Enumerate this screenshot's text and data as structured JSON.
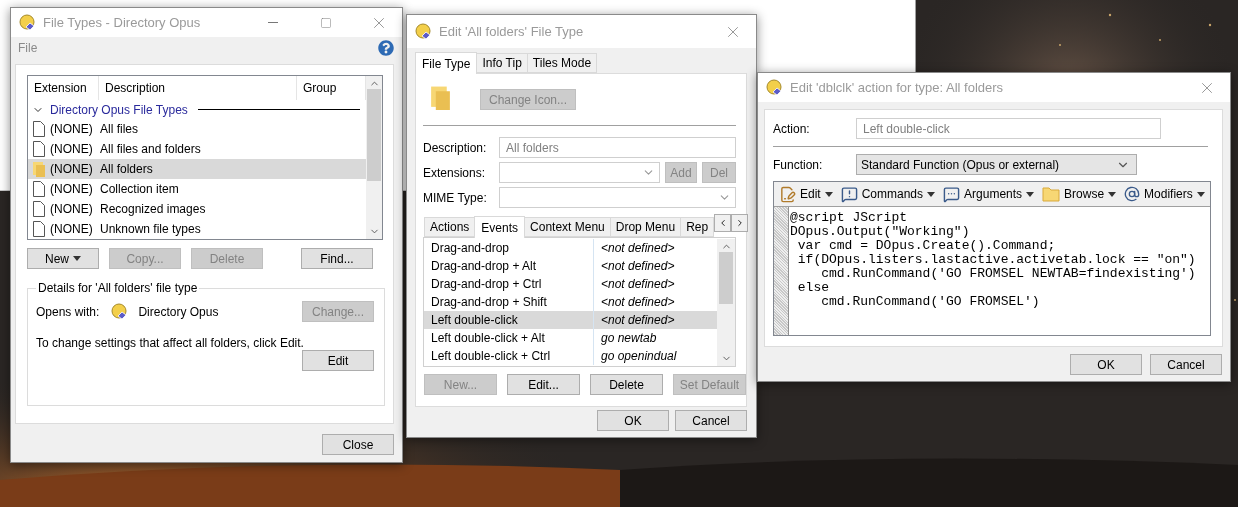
{
  "file_types_window": {
    "title": "File Types - Directory Opus",
    "menu": [
      "File"
    ],
    "table": {
      "columns": [
        "Extension",
        "Description",
        "Group"
      ],
      "group": {
        "label": "Directory Opus File Types",
        "expanded": true
      },
      "rows": [
        {
          "kind": "file",
          "extension": "(NONE)",
          "description": "All files",
          "selected": false
        },
        {
          "kind": "file",
          "extension": "(NONE)",
          "description": "All files and folders",
          "selected": false
        },
        {
          "kind": "folder",
          "extension": "(NONE)",
          "description": "All folders",
          "selected": true
        },
        {
          "kind": "file",
          "extension": "(NONE)",
          "description": "Collection item",
          "selected": false
        },
        {
          "kind": "file",
          "extension": "(NONE)",
          "description": "Recognized images",
          "selected": false
        },
        {
          "kind": "file",
          "extension": "(NONE)",
          "description": "Unknown file types",
          "selected": false
        }
      ]
    },
    "buttons": [
      {
        "label": "New",
        "disabled": false,
        "dropdown": true
      },
      {
        "label": "Copy...",
        "disabled": true,
        "dropdown": false
      },
      {
        "label": "Delete",
        "disabled": true,
        "dropdown": false
      },
      {
        "label": "Find...",
        "disabled": false,
        "dropdown": false
      }
    ],
    "details": {
      "title": "Details for 'All folders' file type",
      "opens_with_label": "Opens with:",
      "opens_with": "Directory Opus",
      "change_button": {
        "label": "Change...",
        "disabled": true
      },
      "note": "To change settings that affect all folders, click Edit.",
      "edit_button": {
        "label": "Edit",
        "disabled": false
      }
    },
    "close_button": {
      "label": "Close",
      "disabled": false
    }
  },
  "edit_type_window": {
    "title": "Edit 'All folders' File Type",
    "tabs": [
      {
        "label": "File Type",
        "selected": true
      },
      {
        "label": "Info Tip",
        "selected": false
      },
      {
        "label": "Tiles Mode",
        "selected": false
      }
    ],
    "change_icon_button": {
      "label": "Change Icon...",
      "disabled": true
    },
    "fields": [
      {
        "kind": "text",
        "label": "Description:",
        "value": "All folders"
      },
      {
        "kind": "combo",
        "label": "Extensions:",
        "buttons": [
          {
            "label": "Add",
            "disabled": true
          },
          {
            "label": "Del",
            "disabled": true
          }
        ]
      },
      {
        "kind": "combo",
        "label": "MIME Type:"
      }
    ],
    "event_tabs": [
      {
        "label": "Actions",
        "selected": false
      },
      {
        "label": "Events",
        "selected": true
      },
      {
        "label": "Context Menu",
        "selected": false
      },
      {
        "label": "Drop Menu",
        "selected": false
      },
      {
        "label": "Rep",
        "selected": false
      }
    ],
    "events": [
      {
        "event": "Drag-and-drop",
        "command": "<not defined>",
        "selected": false
      },
      {
        "event": "Drag-and-drop + Alt",
        "command": "<not defined>",
        "selected": false
      },
      {
        "event": "Drag-and-drop + Ctrl",
        "command": "<not defined>",
        "selected": false
      },
      {
        "event": "Drag-and-drop + Shift",
        "command": "<not defined>",
        "selected": false
      },
      {
        "event": "Left double-click",
        "command": "<not defined>",
        "selected": true
      },
      {
        "event": "Left double-click + Alt",
        "command": "go newtab",
        "selected": false
      },
      {
        "event": "Left double-click + Ctrl",
        "command": "go openindual",
        "selected": false
      }
    ],
    "buttons": [
      {
        "label": "New...",
        "disabled": true
      },
      {
        "label": "Edit...",
        "disabled": false
      },
      {
        "label": "Delete",
        "disabled": false
      },
      {
        "label": "Set Default",
        "disabled": true
      }
    ],
    "ok_button": {
      "label": "OK"
    },
    "cancel_button": {
      "label": "Cancel"
    }
  },
  "edit_action_window": {
    "title": "Edit 'dblclk' action for type: All folders",
    "action_label": "Action:",
    "action_value": "Left double-click",
    "function_label": "Function:",
    "function_value": "Standard Function (Opus or external)",
    "toolbar": [
      {
        "kind": "edit",
        "label": "Edit"
      },
      {
        "kind": "commands",
        "label": "Commands"
      },
      {
        "kind": "arguments",
        "label": "Arguments"
      },
      {
        "kind": "browse",
        "label": "Browse"
      },
      {
        "kind": "modifiers",
        "label": "Modifiers"
      }
    ],
    "code": [
      "@script JScript",
      "DOpus.Output(\"Working\")",
      " var cmd = DOpus.Create().Command;",
      " if(DOpus.listers.lastactive.activetab.lock == \"on\")",
      "    cmd.RunCommand('GO FROMSEL NEWTAB=findexisting')",
      " else",
      "    cmd.RunCommand('GO FROMSEL')"
    ],
    "ok_button": {
      "label": "OK"
    },
    "cancel_button": {
      "label": "Cancel"
    }
  }
}
